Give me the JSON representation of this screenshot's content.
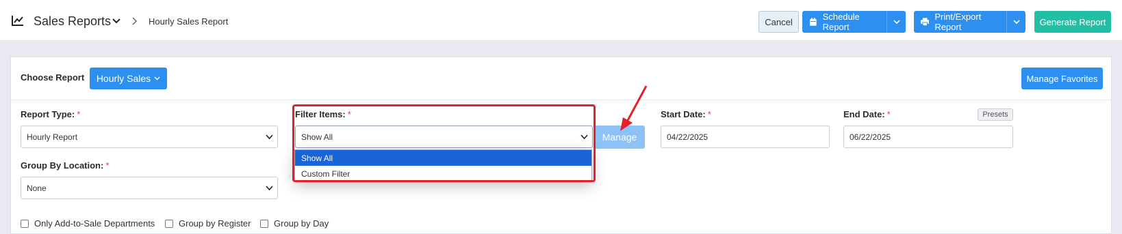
{
  "topbar": {
    "title": "Sales Reports",
    "breadcrumb": "Hourly Sales Report",
    "cancel_label": "Cancel",
    "schedule_label": "Schedule Report",
    "print_label": "Print/Export Report",
    "generate_label": "Generate Report"
  },
  "card": {
    "choose_report_label": "Choose Report",
    "report_dropdown_label": "Hourly Sales",
    "manage_favorites_label": "Manage Favorites"
  },
  "form": {
    "report_type_label": "Report Type:",
    "report_type_value": "Hourly Report",
    "filter_items_label": "Filter Items:",
    "filter_items_value": "Show All",
    "manage_label": "Manage",
    "start_date_label": "Start Date:",
    "start_date_value": "04/22/2025",
    "end_date_label": "End Date:",
    "end_date_value": "06/22/2025",
    "presets_label": "Presets",
    "group_by_location_label": "Group By Location:",
    "group_by_location_value": "None",
    "required_mark": "*"
  },
  "filter_options": [
    "Show All",
    "Custom Filter"
  ],
  "checkboxes": {
    "only_add_to_sale": "Only Add-to-Sale Departments",
    "group_by_register": "Group by Register",
    "group_by_day": "Group by Day"
  },
  "colors": {
    "primary": "#2d8fef",
    "success": "#21c0a4",
    "highlight": "#e6202a",
    "selected_option": "#1a64d6"
  }
}
